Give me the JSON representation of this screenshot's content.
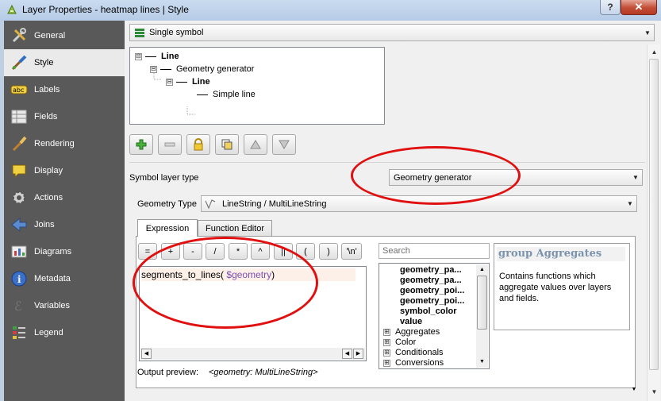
{
  "window": {
    "title": "Layer Properties - heatmap lines | Style",
    "help_label": "?",
    "close_label": "✕"
  },
  "sidebar": {
    "items": [
      {
        "label": "General",
        "icon": "wrench-screwdriver-icon"
      },
      {
        "label": "Style",
        "icon": "paintbrush-style-icon"
      },
      {
        "label": "Labels",
        "icon": "abc-labels-icon"
      },
      {
        "label": "Fields",
        "icon": "table-fields-icon"
      },
      {
        "label": "Rendering",
        "icon": "brush-rendering-icon"
      },
      {
        "label": "Display",
        "icon": "speech-bubble-icon"
      },
      {
        "label": "Actions",
        "icon": "gear-actions-icon"
      },
      {
        "label": "Joins",
        "icon": "joins-arrow-icon"
      },
      {
        "label": "Diagrams",
        "icon": "diagram-chart-icon"
      },
      {
        "label": "Metadata",
        "icon": "info-circle-icon"
      },
      {
        "label": "Variables",
        "icon": "epsilon-variables-icon"
      },
      {
        "label": "Legend",
        "icon": "legend-list-icon"
      }
    ],
    "active_index": 1
  },
  "renderer": {
    "selected": "Single symbol"
  },
  "symbol_tree": {
    "rows": [
      {
        "label": "Line",
        "bold": true
      },
      {
        "label": "Geometry generator",
        "bold": false
      },
      {
        "label": "Line",
        "bold": true
      },
      {
        "label": "Simple line",
        "bold": false
      }
    ],
    "expand_glyph": "⊟"
  },
  "tool_buttons": [
    {
      "name": "add-layer-button",
      "icon": "plus-icon"
    },
    {
      "name": "remove-layer-button",
      "icon": "minus-icon"
    },
    {
      "name": "lock-layer-button",
      "icon": "lock-icon"
    },
    {
      "name": "duplicate-layer-button",
      "icon": "duplicate-icon"
    },
    {
      "name": "move-up-button",
      "icon": "triangle-up-icon"
    },
    {
      "name": "move-down-button",
      "icon": "triangle-down-icon"
    }
  ],
  "symbol_layer_type": {
    "label": "Symbol layer type",
    "selected": "Geometry generator"
  },
  "geometry_type": {
    "label": "Geometry Type",
    "selected": "LineString / MultiLineString"
  },
  "tabs": [
    {
      "label": "Expression",
      "active": true
    },
    {
      "label": "Function Editor",
      "active": false
    }
  ],
  "operators": [
    "=",
    "+",
    "-",
    "/",
    "*",
    "^",
    "||",
    "(",
    ")",
    "'\\n'"
  ],
  "expression": {
    "func": "segments_to_lines(",
    "var": " $geometry",
    "close": ")"
  },
  "search": {
    "placeholder": "Search",
    "value": ""
  },
  "function_list": {
    "bold_items": [
      "geometry_pa...",
      "geometry_pa...",
      "geometry_poi...",
      "geometry_poi...",
      "symbol_color",
      "value"
    ],
    "groups": [
      "Aggregates",
      "Color",
      "Conditionals",
      "Conversions"
    ],
    "expand_glyph": "⊞"
  },
  "help_panel": {
    "title": "group Aggregates",
    "description": "Contains functions which aggregate values over layers and fields."
  },
  "output_preview": {
    "label": "Output preview:",
    "value": "<geometry: MultiLineString>"
  },
  "colors": {
    "annotation": "#e01010",
    "sidebar_bg": "#595959",
    "help_title": "#7c93ae"
  }
}
